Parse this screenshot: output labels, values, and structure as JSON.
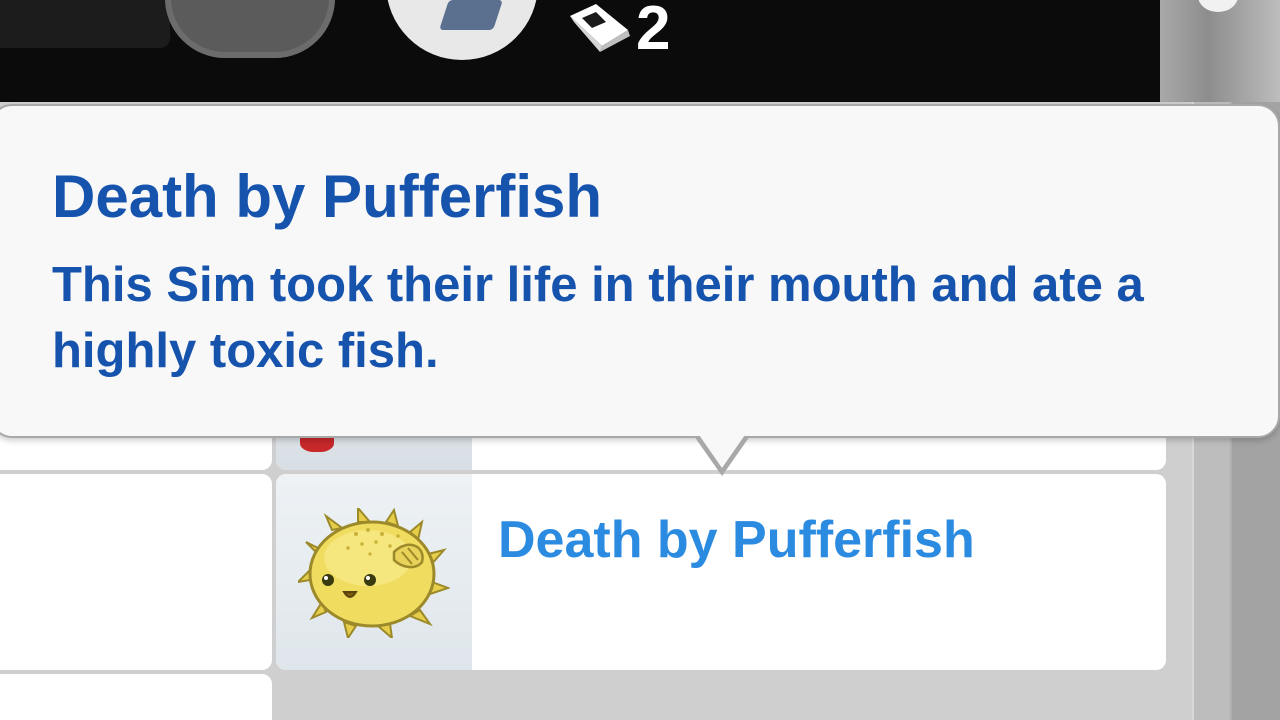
{
  "hud": {
    "book_icon": "book-icon",
    "book_count": "2"
  },
  "tooltip": {
    "title": "Death by Pufferfish",
    "description": "This Sim took their life in their mouth and ate a highly toxic fish."
  },
  "list": {
    "selected_item": {
      "icon": "pufferfish-icon",
      "label": "Death by Pufferfish"
    }
  },
  "colors": {
    "tooltip_text": "#1653ad",
    "item_label": "#2b8be0"
  }
}
